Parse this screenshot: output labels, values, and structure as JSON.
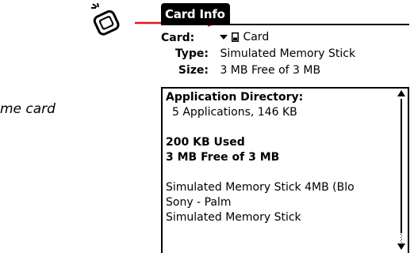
{
  "caption": {
    "text": "me card"
  },
  "icons": {
    "memory_card": "memory-card-insert-icon",
    "arrow": "right-arrow-icon",
    "arrow_color": "#e8141b"
  },
  "palm": {
    "title": "Card Info",
    "card": {
      "label": "Card:",
      "value": "Card"
    },
    "type": {
      "label": "Type:",
      "value": "Simulated Memory Stick"
    },
    "size": {
      "label": "Size:",
      "value": "3 MB Free of 3 MB"
    },
    "directory": {
      "heading": "Application Directory:",
      "summary": "5 Applications, 146 KB",
      "used": "200 KB Used",
      "free": "3 MB Free of 3 MB",
      "details": [
        "Simulated Memory Stick 4MB (Blo",
        "Sony - Palm",
        "Simulated Memory Stick"
      ]
    }
  }
}
